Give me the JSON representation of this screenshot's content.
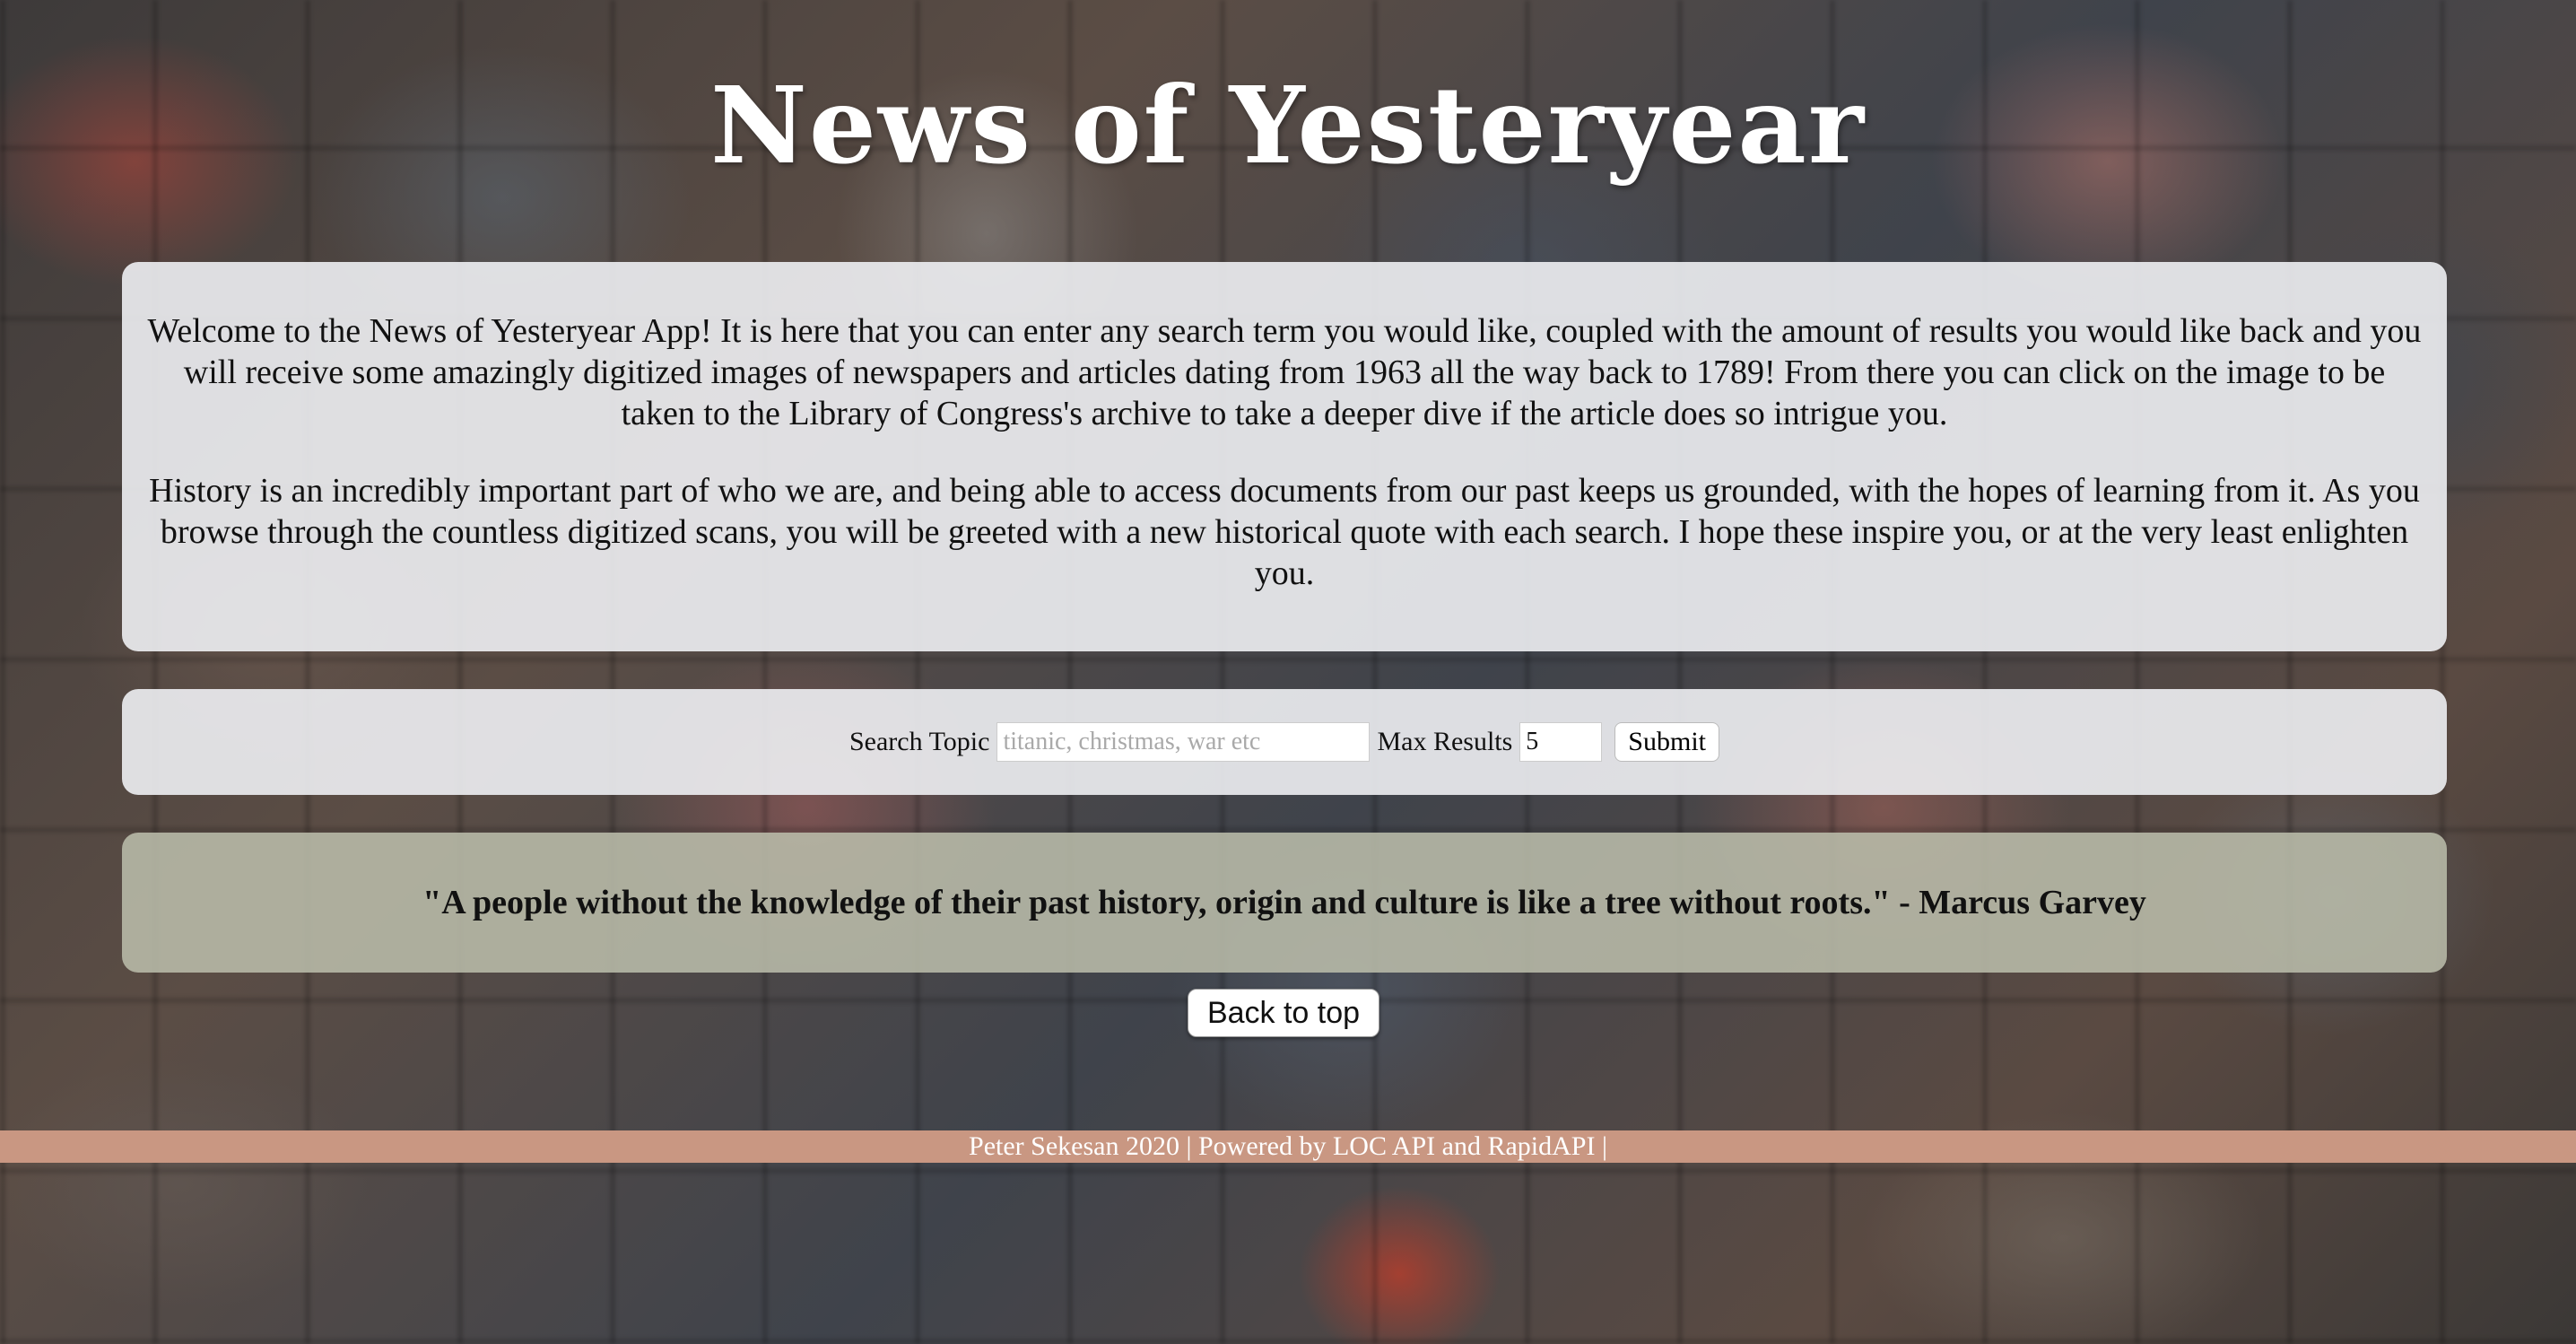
{
  "app": {
    "title": "News of Yesteryear"
  },
  "intro": {
    "paragraph1": "Welcome to the News of Yesteryear App! It is here that you can enter any search term you would like, coupled with the amount of results you would like back and you will receive some amazingly digitized images of newspapers and articles dating from 1963 all the way back to 1789! From there you can click on the image to be taken to the Library of Congress's archive to take a deeper dive if the article does so intrigue you.",
    "paragraph2": "History is an incredibly important part of who we are, and being able to access documents from our past keeps us grounded, with the hopes of learning from it. As you browse through the countless digitized scans, you will be greeted with a new historical quote with each search. I hope these inspire you, or at the very least enlighten you."
  },
  "search": {
    "topic_label": "Search Topic",
    "topic_placeholder": "titanic, christmas, war etc",
    "topic_value": "",
    "max_label": "Max Results",
    "max_value": "5",
    "submit_label": "Submit"
  },
  "quote": {
    "text": "\"A people without the knowledge of their past history, origin and culture is like a tree without roots.\" - Marcus Garvey"
  },
  "back_to_top": {
    "label": "Back to top"
  },
  "footer": {
    "text": "Peter Sekesan 2020 | Powered by LOC API and RapidAPI |"
  },
  "colors": {
    "panel_bg": "#eef0f3",
    "quote_bg": "#babcaa",
    "footer_bg": "#c99782"
  }
}
